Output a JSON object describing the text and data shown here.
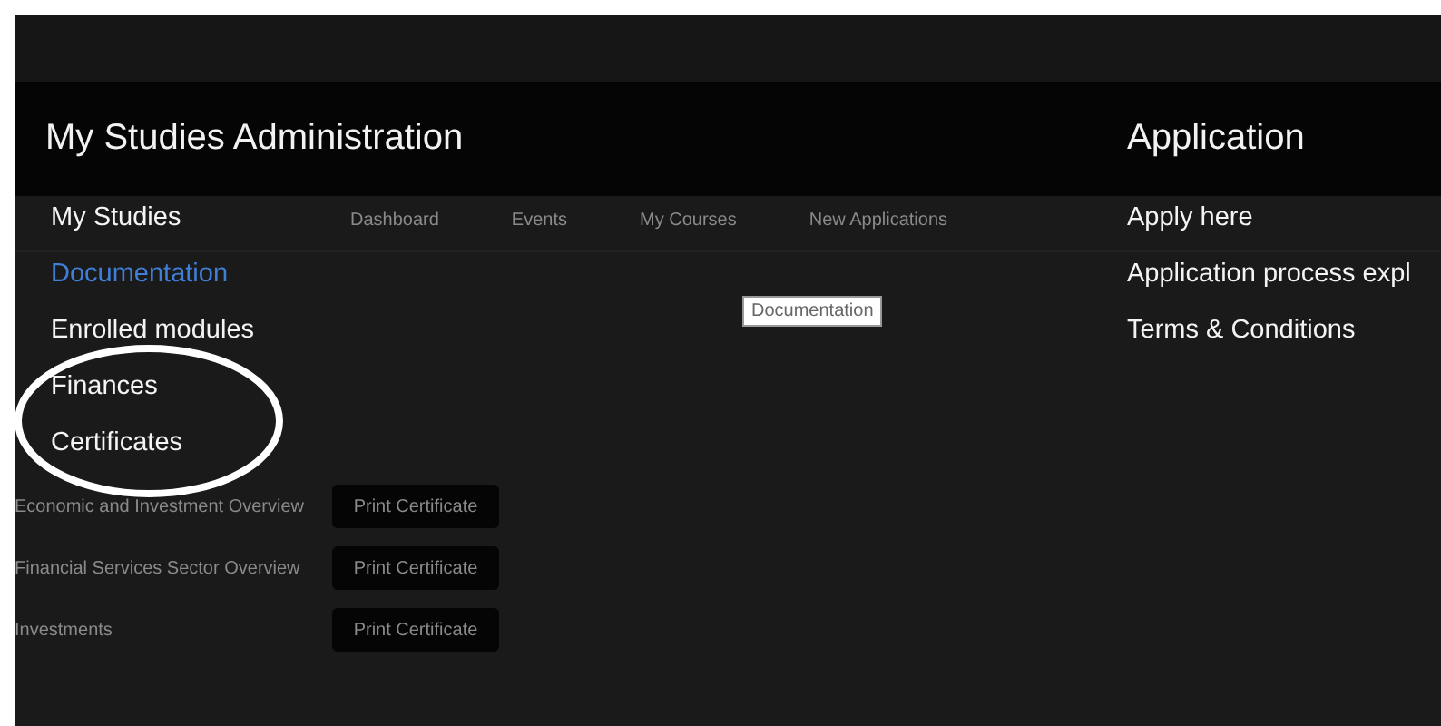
{
  "nav": [
    "Dashboard",
    "Events",
    "My Courses",
    "New Applications"
  ],
  "menu": {
    "columns": [
      {
        "title": "My Studies Administration",
        "items": [
          {
            "label": "My Studies",
            "selected": false
          },
          {
            "label": "Documentation",
            "selected": true
          },
          {
            "label": "Enrolled modules",
            "selected": false
          },
          {
            "label": "Finances",
            "selected": false
          },
          {
            "label": "Certificates",
            "selected": false
          }
        ]
      },
      {
        "title": "Application",
        "items": [
          {
            "label": "Apply here",
            "selected": false
          },
          {
            "label": "Application process expl",
            "selected": false
          },
          {
            "label": "Terms & Conditions",
            "selected": false
          }
        ]
      }
    ]
  },
  "tooltip": "Documentation",
  "certificates": [
    {
      "course": "Economic and Investment Overview",
      "button": "Print Certificate"
    },
    {
      "course": "Financial Services Sector Overview",
      "button": "Print Certificate"
    },
    {
      "course": "Investments",
      "button": "Print Certificate"
    }
  ]
}
